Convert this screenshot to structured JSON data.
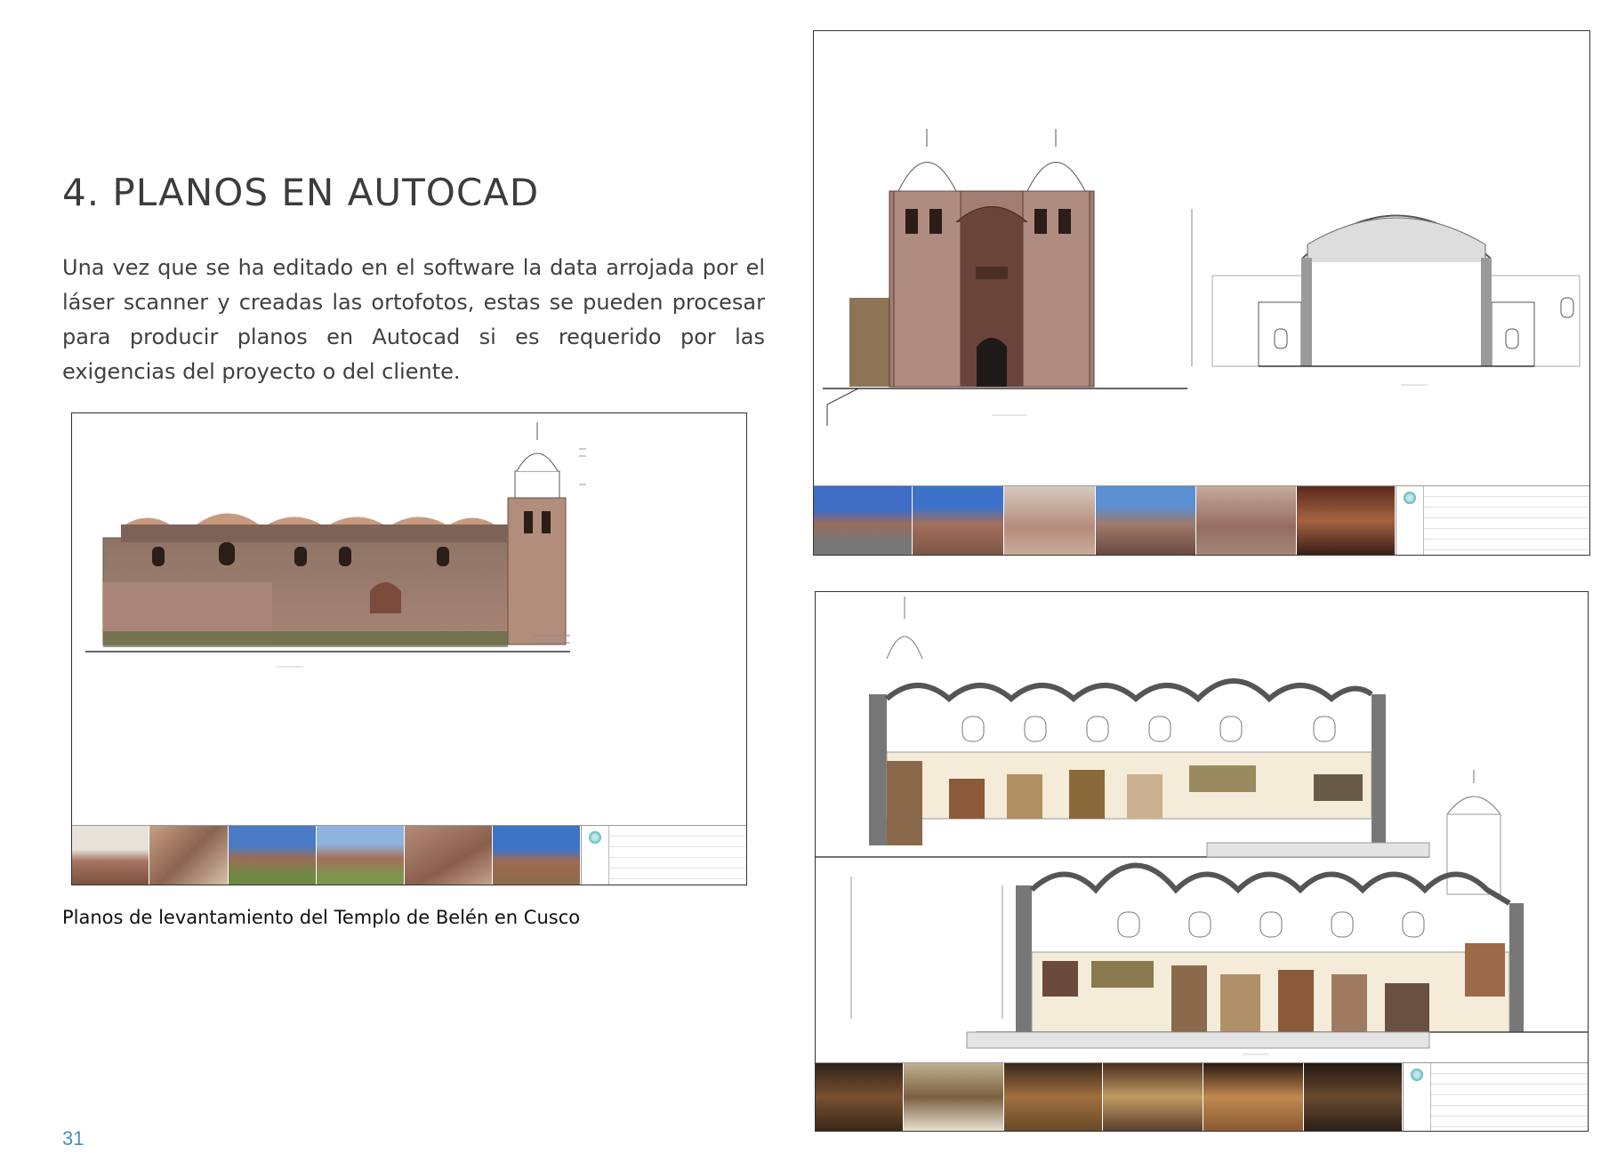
{
  "heading": "4. PLANOS EN AUTOCAD",
  "body": "Una vez que se ha editado en el software la data arrojada por el láser scanner y creadas las ortofotos, estas se pueden procesar para producir planos en Autocad si es requerido por las exigencias del proyecto o del cliente.",
  "caption": "Planos de levantamiento del Templo de Belén en Cusco",
  "page_number": "31",
  "colors": {
    "heading": "#3c3c3c",
    "page_number": "#4a8fb8",
    "stone": "#9c7a6b",
    "stone_dark": "#6e4e42",
    "title_block_logo": "#5bb9b9"
  },
  "drawings": {
    "side_elevation": {
      "thumbnails": 6
    },
    "facade_and_section": {
      "thumbnails": 6
    },
    "longitudinal_sections": {
      "thumbnails": 6
    }
  }
}
